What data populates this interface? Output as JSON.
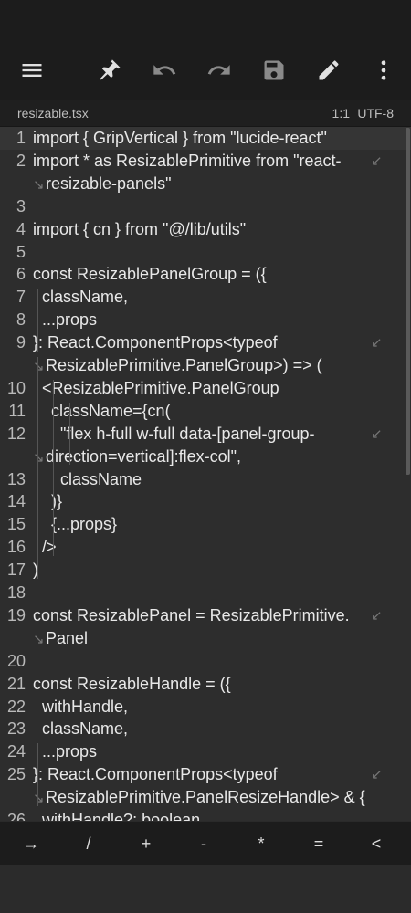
{
  "toolbar": {
    "icons": [
      "menu-icon",
      "pin-icon",
      "undo-icon",
      "redo-icon",
      "save-icon",
      "edit-icon",
      "more-vert-icon"
    ]
  },
  "tab": {
    "filename": "resizable.tsx",
    "cursor": "1:1",
    "encoding": "UTF-8"
  },
  "editor": {
    "lines": [
      {
        "num": "1",
        "text": "import { GripVertical } from \"lucide-react\""
      },
      {
        "num": "2",
        "text": "import * as ResizablePrimitive from \"react-",
        "cont": "resizable-panels\""
      },
      {
        "num": "3",
        "text": ""
      },
      {
        "num": "4",
        "text": "import { cn } from \"@/lib/utils\""
      },
      {
        "num": "5",
        "text": ""
      },
      {
        "num": "6",
        "text": "const ResizablePanelGroup = ({"
      },
      {
        "num": "7",
        "text": "  className,"
      },
      {
        "num": "8",
        "text": "  ...props"
      },
      {
        "num": "9",
        "text": "}: React.ComponentProps<typeof",
        "cont": "ResizablePrimitive.PanelGroup>) => ("
      },
      {
        "num": "10",
        "text": "  <ResizablePrimitive.PanelGroup"
      },
      {
        "num": "11",
        "text": "    className={cn("
      },
      {
        "num": "12",
        "text": "      \"flex h-full w-full data-[panel-group-",
        "cont": "direction=vertical]:flex-col\","
      },
      {
        "num": "13",
        "text": "      className"
      },
      {
        "num": "14",
        "text": "    )}"
      },
      {
        "num": "15",
        "text": "    {...props}"
      },
      {
        "num": "16",
        "text": "  />"
      },
      {
        "num": "17",
        "text": ")"
      },
      {
        "num": "18",
        "text": ""
      },
      {
        "num": "19",
        "text": "const ResizablePanel = ResizablePrimitive.",
        "cont": "Panel"
      },
      {
        "num": "20",
        "text": ""
      },
      {
        "num": "21",
        "text": "const ResizableHandle = ({"
      },
      {
        "num": "22",
        "text": "  withHandle,"
      },
      {
        "num": "23",
        "text": "  className,"
      },
      {
        "num": "24",
        "text": "  ...props"
      },
      {
        "num": "25",
        "text": "}: React.ComponentProps<typeof",
        "cont": "ResizablePrimitive.PanelResizeHandle> & {"
      },
      {
        "num": "26",
        "text": "  withHandle?: boolean"
      }
    ]
  },
  "keybar": {
    "keys": [
      "→",
      "/",
      "+",
      "-",
      "*",
      "=",
      "<"
    ]
  }
}
